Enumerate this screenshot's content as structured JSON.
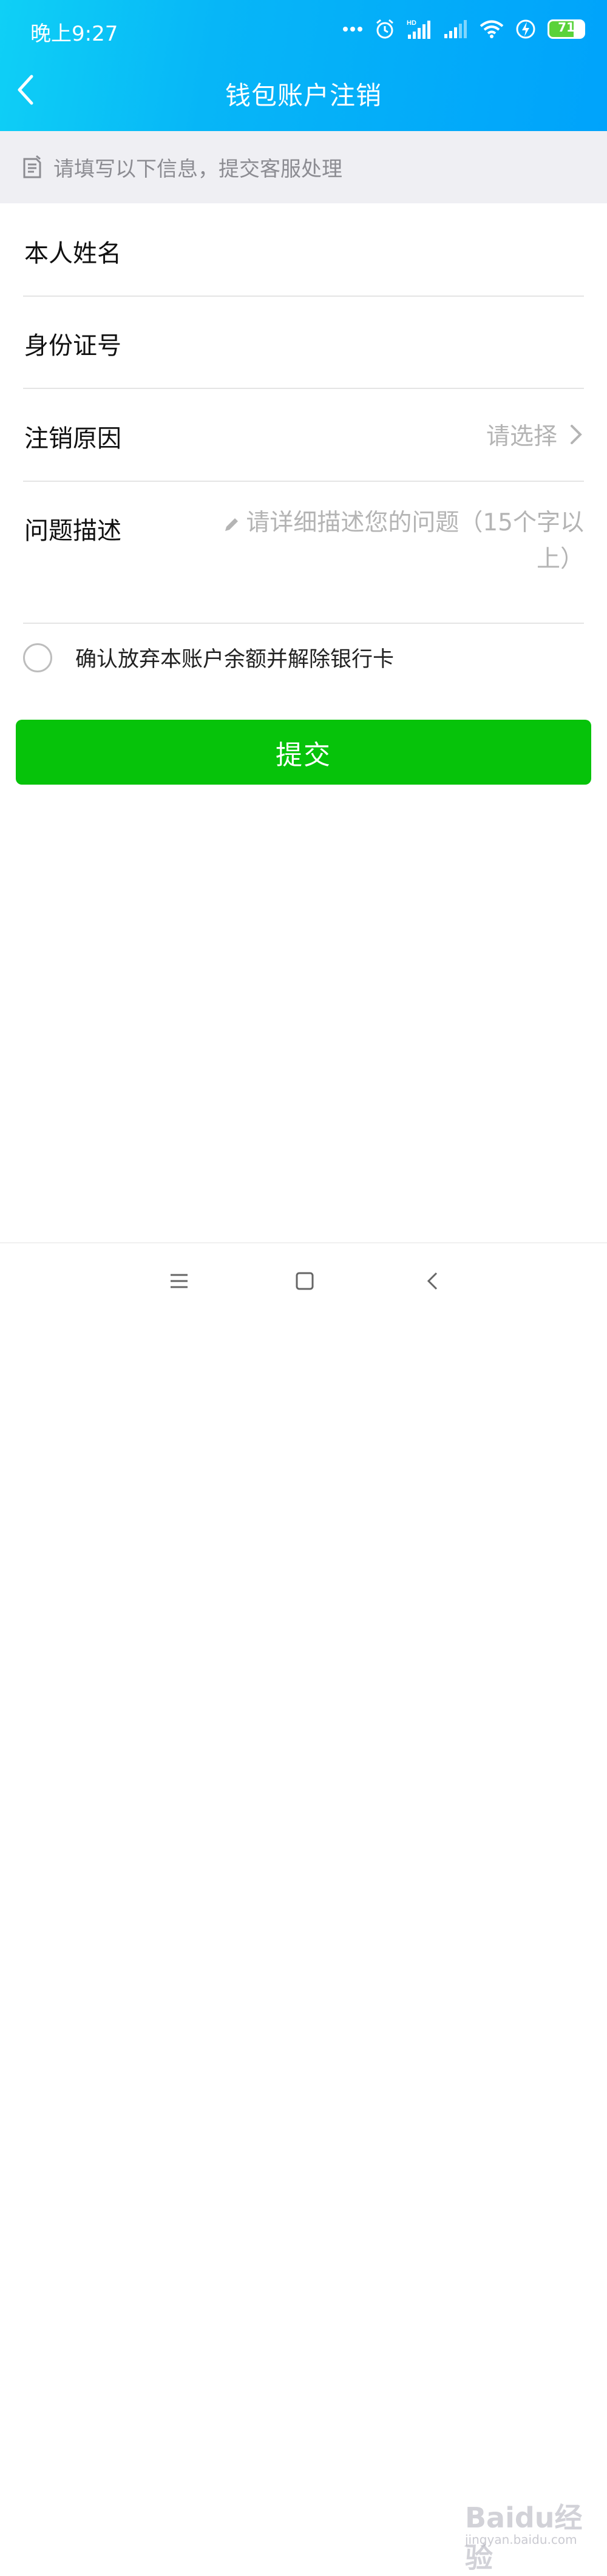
{
  "status_bar": {
    "time": "晚上9:27",
    "signal_label": "HD",
    "battery": 71,
    "battery_text": "71"
  },
  "header": {
    "title": "钱包账户注销",
    "back_icon": "chevron-left-icon"
  },
  "tip": {
    "icon": "document-icon",
    "text": "请填写以下信息，提交客服处理"
  },
  "form": {
    "name_label": "本人姓名",
    "id_label": "身份证号",
    "reason_label": "注销原因",
    "reason_placeholder": "请选择",
    "desc_label": "问题描述",
    "desc_placeholder": "请详细描述您的问题（15个字以上）"
  },
  "confirm": {
    "checked": false,
    "text": "确认放弃本账户余额并解除银行卡"
  },
  "submit": {
    "label": "提交"
  },
  "navbar": {
    "icons": [
      "menu-icon",
      "home-square-icon",
      "back-triangle-icon"
    ]
  },
  "watermark": {
    "text": "Baidu经验",
    "sub": "jingyan.baidu.com"
  },
  "colors": {
    "header_start": "#0fd0f6",
    "header_end": "#00a3fb",
    "submit": "#06c30a",
    "tip_bg": "#efeff3"
  }
}
